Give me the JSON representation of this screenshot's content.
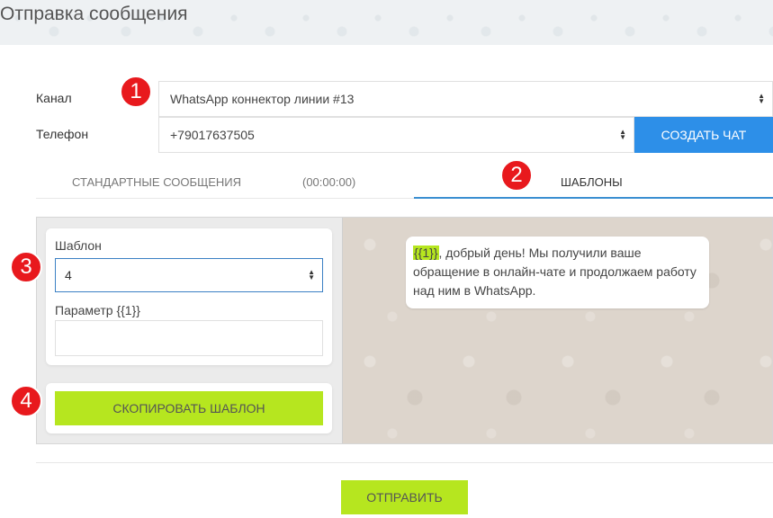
{
  "page": {
    "title": "Отправка сообщения"
  },
  "form": {
    "channel_label": "Канал",
    "channel_value": "WhatsApp коннектор линии #13",
    "phone_label": "Телефон",
    "phone_value": "+79017637505",
    "create_chat_label": "СОЗДАТЬ ЧАТ"
  },
  "tabs": [
    {
      "label": "СТАНДАРТНЫЕ СООБЩЕНИЯ",
      "active": false
    },
    {
      "label": "(00:00:00)",
      "active": false
    },
    {
      "label": "ШАБЛОНЫ",
      "active": true
    }
  ],
  "template_panel": {
    "template_label": "Шаблон",
    "template_value": "4",
    "param_label": "Параметр {{1}}",
    "param_value": "",
    "copy_button_label": "СКОПИРОВАТЬ ШАБЛОН"
  },
  "preview": {
    "highlight": "{{1}}",
    "text": ", добрый день! Мы получили ваше обращение в онлайн-чате и продолжаем работу над ним в WhatsApp."
  },
  "footer": {
    "send_label": "ОТПРАВИТЬ"
  },
  "badges": [
    "1",
    "2",
    "3",
    "4"
  ],
  "colors": {
    "accent_blue": "#2d8fe8",
    "accent_green": "#b6e61f",
    "badge_red": "#e8191d",
    "tab_underline": "#3b8fd1"
  },
  "icons": {
    "select_arrows": "up-down-arrows-icon"
  }
}
